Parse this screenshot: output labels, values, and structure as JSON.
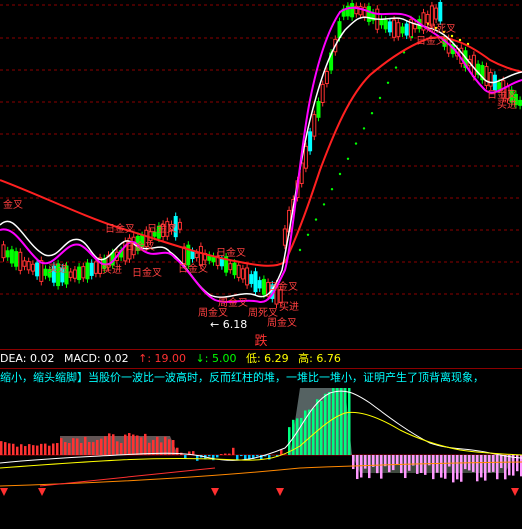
{
  "main_chart": {
    "labels": [
      {
        "id": "l1",
        "text": "金叉"
      },
      {
        "id": "l2",
        "text": "日金叉"
      },
      {
        "id": "l3",
        "text": "买进"
      },
      {
        "id": "l4",
        "text": "日金叉"
      },
      {
        "id": "l5",
        "text": "日金叉"
      },
      {
        "id": "l6",
        "text": "买进"
      },
      {
        "id": "l7",
        "text": "日金叉"
      },
      {
        "id": "l8",
        "text": "日金叉"
      },
      {
        "id": "l9",
        "text": "日金叉"
      },
      {
        "id": "l10",
        "text": "周金叉"
      },
      {
        "id": "l11",
        "text": "周金叉"
      },
      {
        "id": "l12",
        "text": "周死叉"
      },
      {
        "id": "l13",
        "text": "周金叉"
      },
      {
        "id": "l14",
        "text": "买进"
      },
      {
        "id": "l15",
        "text": "日金叉"
      },
      {
        "id": "l16",
        "text": "周死叉"
      },
      {
        "id": "l17",
        "text": "日金叉"
      },
      {
        "id": "l18",
        "text": "买进"
      },
      {
        "id": "l19",
        "text": "日金叉"
      }
    ],
    "low_marker": "6.18",
    "colors": {
      "up": "#ff3232",
      "down": "#00ff00",
      "flat": "#00ffff",
      "ma_white": "#ffffff",
      "ma_magenta": "#ff00ff",
      "ma_red": "#ff2020",
      "ma_yellow": "#ffff00",
      "sar": "#00ff00"
    }
  },
  "separator_label": "跌",
  "status_bar": {
    "items": [
      {
        "text": "DEA: 0.02",
        "color": "#ffffff"
      },
      {
        "text": "MACD: 0.02",
        "color": "#ffffff"
      },
      {
        "text": "↑: 19.00",
        "color": "#ff3232"
      },
      {
        "text": "↓: 5.00",
        "color": "#00ff00"
      },
      {
        "text": "低: 6.29",
        "color": "#ffff00"
      },
      {
        "text": "高: 6.76",
        "color": "#ffff00"
      }
    ]
  },
  "ticker_text": "缩小，缩头缩脚】当股价一波比一波高时，反而红柱的堆，一堆比一堆小，证明产生了顶背离现象，"
}
